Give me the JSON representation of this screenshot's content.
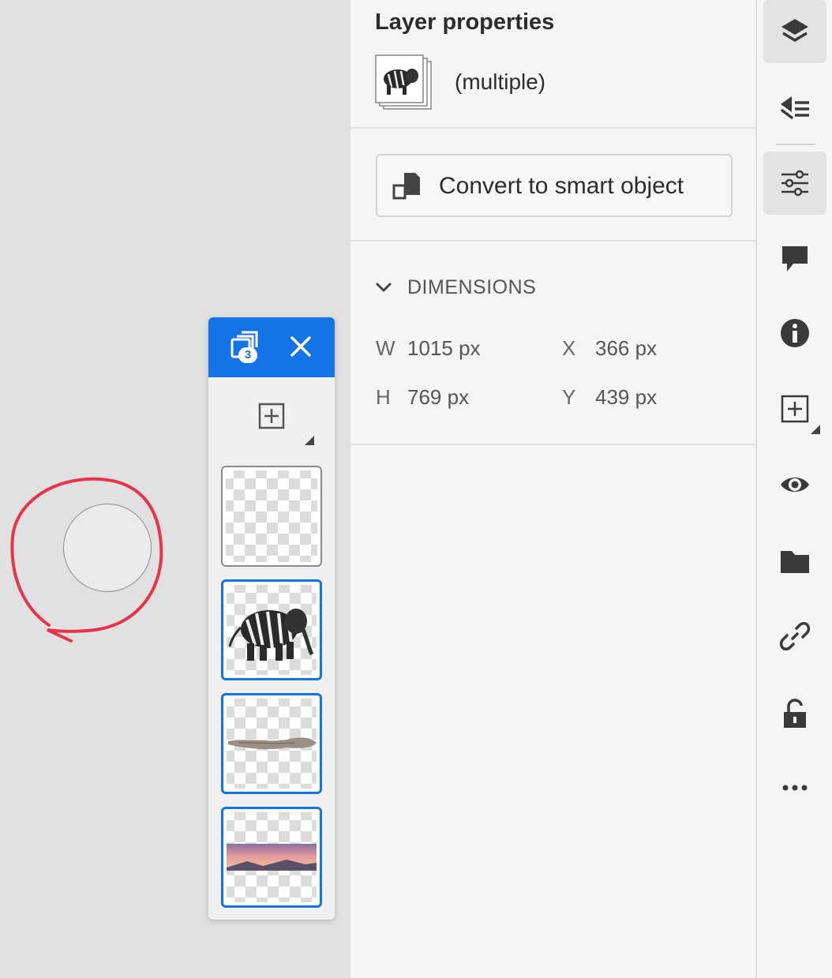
{
  "panel": {
    "title": "Layer properties",
    "selection_label": "(multiple)",
    "convert_button_label": "Convert to smart object",
    "dimensions_section_label": "DIMENSIONS",
    "dimensions": {
      "w_key": "W",
      "w_value": "1015 px",
      "h_key": "H",
      "h_value": "769 px",
      "x_key": "X",
      "x_value": "366 px",
      "y_key": "Y",
      "y_value": "439 px"
    }
  },
  "layers_strip": {
    "selected_count": "3",
    "layers": [
      {
        "name": "empty-layer",
        "selected": false
      },
      {
        "name": "zebra-elephant-layer",
        "selected": true
      },
      {
        "name": "driftwood-layer",
        "selected": true
      },
      {
        "name": "sky-layer",
        "selected": true
      }
    ]
  },
  "toolbar": {
    "items": [
      "layers-icon",
      "layer-stack-icon",
      "properties-icon",
      "comment-icon",
      "info-icon",
      "add-icon",
      "visibility-icon",
      "folder-icon",
      "link-icon",
      "unlock-icon",
      "more-icon"
    ],
    "active": [
      "layers-icon",
      "properties-icon"
    ]
  },
  "colors": {
    "accent": "#1473e6",
    "annotation": "#e8344a",
    "panel_bg": "#f5f5f5",
    "canvas_bg": "#e1e1e1"
  }
}
